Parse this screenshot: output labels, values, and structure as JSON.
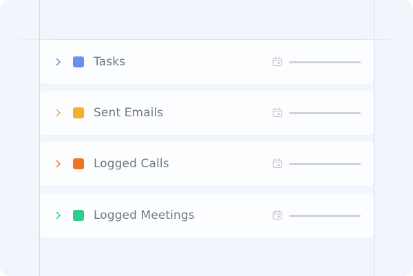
{
  "activities": [
    {
      "label": "Tasks",
      "color": "#6b8ff0",
      "chevron_color": "#5b7fe0",
      "icon": "chevron-right-icon"
    },
    {
      "label": "Sent Emails",
      "color": "#f6ae2d",
      "chevron_color": "#f0a62a",
      "icon": "chevron-right-icon"
    },
    {
      "label": "Logged Calls",
      "color": "#f07622",
      "chevron_color": "#ec6f1f",
      "icon": "chevron-right-icon"
    },
    {
      "label": "Logged Meetings",
      "color": "#2ecc8f",
      "chevron_color": "#27c088",
      "icon": "chevron-right-icon"
    }
  ],
  "row_icons": {
    "expand": "chevron-right-icon",
    "date": "calendar-icon"
  }
}
